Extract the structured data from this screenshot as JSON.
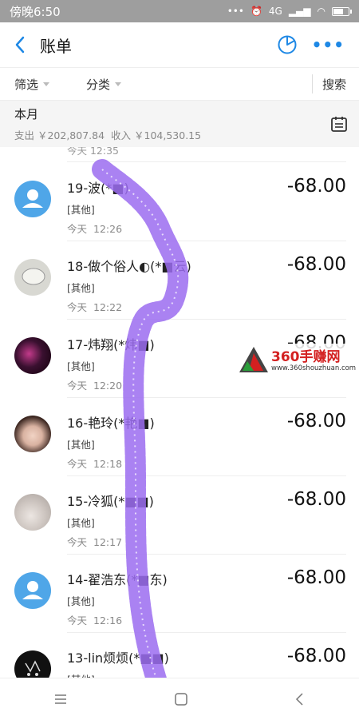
{
  "status_bar": {
    "time": "傍晚6:50",
    "network": "4G"
  },
  "header": {
    "title": "账单",
    "more": "•••"
  },
  "filter": {
    "filter_label": "筛选",
    "category_label": "分类",
    "search_label": "搜索"
  },
  "month": {
    "label": "本月",
    "expense": "支出 ￥202,807.84",
    "income": "收入 ￥104,530.15"
  },
  "partial_time": "今天  12:35",
  "transactions": [
    {
      "name": "19-波(*■)",
      "category": "[其他]",
      "day": "今天",
      "time": "12:26",
      "amount": "-68.00",
      "avatar": "default-avatar"
    },
    {
      "name": "18-做个俗人◐(*■云)",
      "category": "[其他]",
      "day": "今天",
      "time": "12:22",
      "amount": "-68.00",
      "avatar": "photo-avatar"
    },
    {
      "name": "17-炜翔(*炜■)",
      "category": "[其他]",
      "day": "今天",
      "time": "12:20",
      "amount": "-68.00",
      "avatar": "photo-avatar"
    },
    {
      "name": "16-艳玲(*艳■)",
      "category": "[其他]",
      "day": "今天",
      "time": "12:18",
      "amount": "-68.00",
      "avatar": "photo-avatar"
    },
    {
      "name": "15-冷狐(*■■)",
      "category": "[其他]",
      "day": "今天",
      "time": "12:17",
      "amount": "-68.00",
      "avatar": "photo-avatar"
    },
    {
      "name": "14-翟浩东(*■东)",
      "category": "[其他]",
      "day": "今天",
      "time": "12:16",
      "amount": "-68.00",
      "avatar": "default-avatar"
    },
    {
      "name": "13-lin烦烦(*■■)",
      "category": "[其他]",
      "day": "",
      "time": "",
      "amount": "-68.00",
      "avatar": "photo-avatar"
    }
  ],
  "watermark": {
    "text": "360手赚网",
    "url": "www.360shouzhuan.com"
  },
  "colors": {
    "accent": "#1e88e5",
    "avatar_default": "#4fa6e8",
    "doodle": "#9b6cf0"
  }
}
